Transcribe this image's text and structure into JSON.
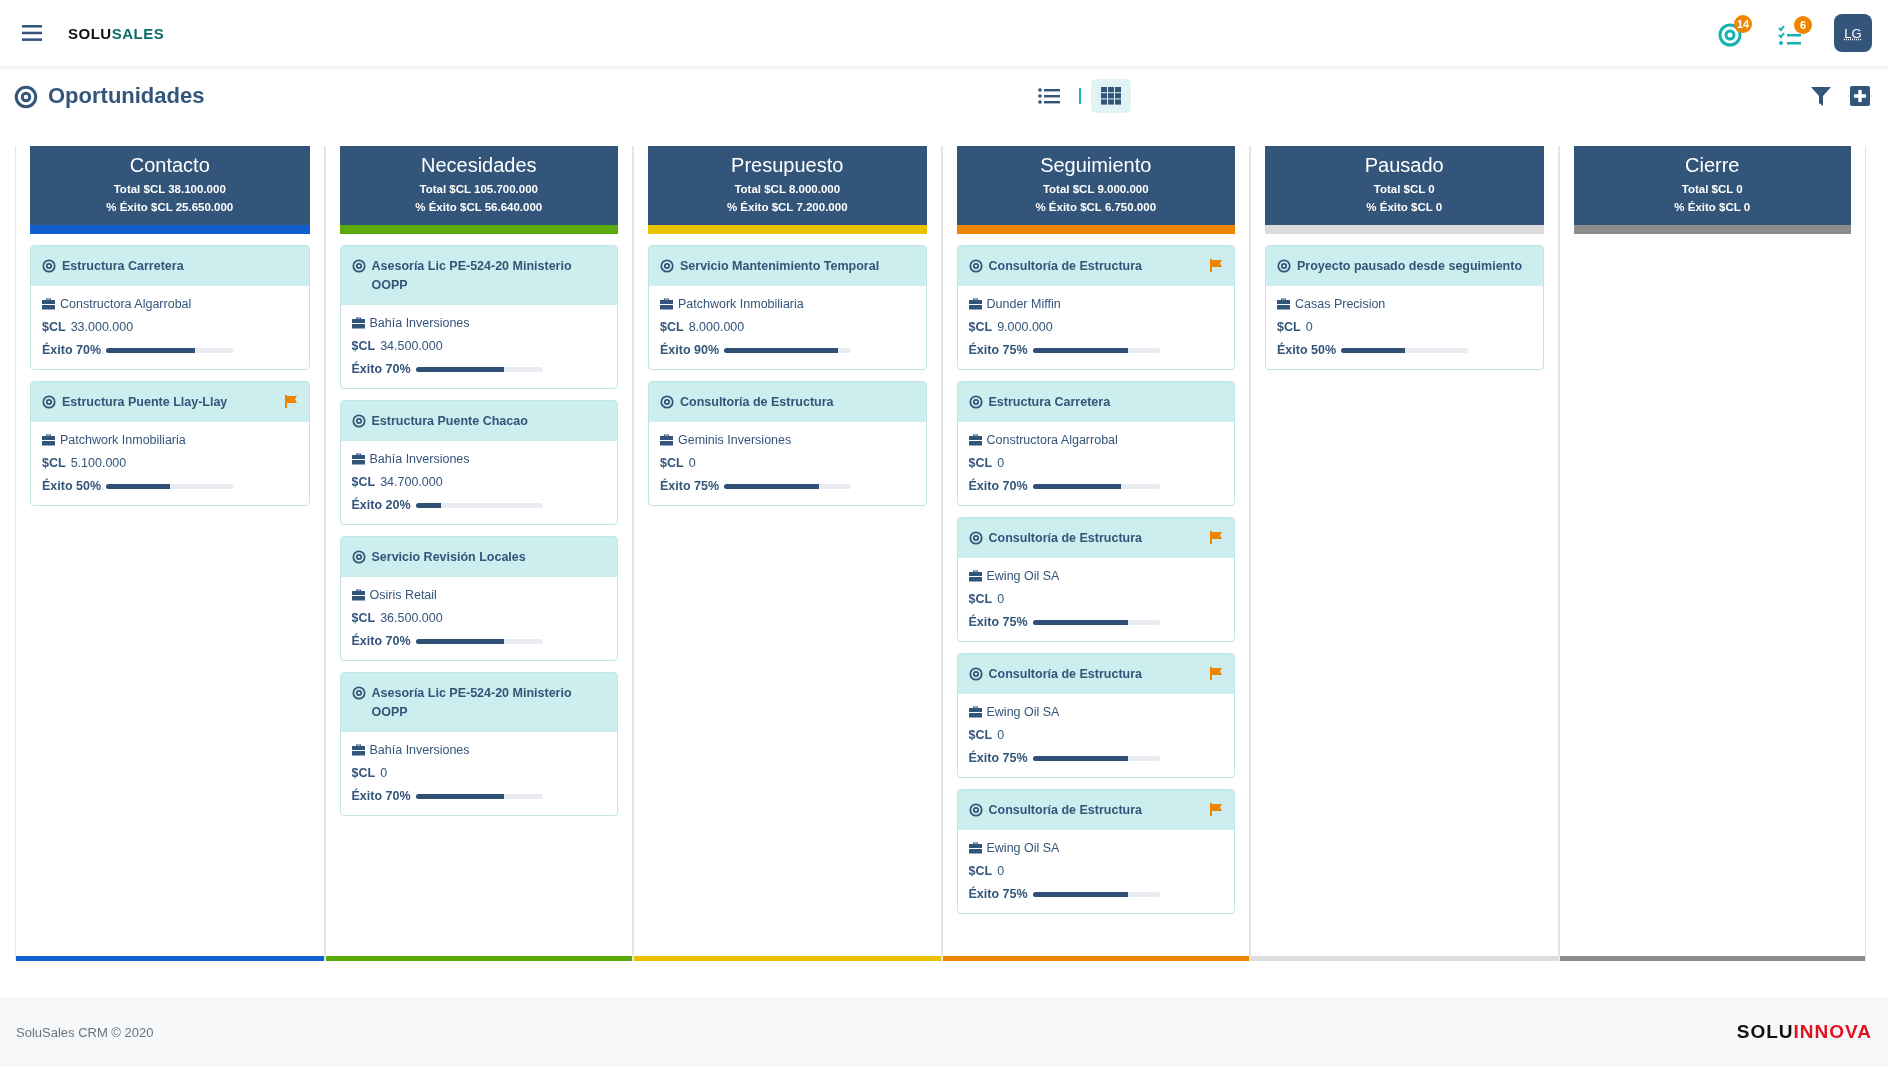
{
  "topbar": {
    "logo": {
      "left": "SOLU",
      "right": "SALES"
    },
    "notifications": [
      {
        "kind": "target",
        "count": "14"
      },
      {
        "kind": "tasks",
        "count": "6"
      }
    ],
    "avatar": "LG"
  },
  "page": {
    "title": "Oportunidades",
    "views": [
      {
        "kind": "list",
        "selected": false
      },
      {
        "kind": "grid",
        "selected": true
      }
    ]
  },
  "columns": [
    {
      "title": "Contacto",
      "total": "Total $CL 38.100.000",
      "success": "% Éxito $CL 25.650.000",
      "color": "#0f5fd0",
      "cards": [
        {
          "title": "Estructura Carretera",
          "flagged": false,
          "company": "Constructora Algarrobal",
          "currency": "$CL",
          "amount": "33.000.000",
          "success_label": "Éxito 70%",
          "level": 0.7
        },
        {
          "title": "Estructura Puente Llay-Llay",
          "flagged": true,
          "company": "Patchwork Inmobiliaria",
          "currency": "$CL",
          "amount": "5.100.000",
          "success_label": "Éxito 50%",
          "level": 0.5
        }
      ]
    },
    {
      "title": "Necesidades",
      "total": "Total $CL 105.700.000",
      "success": "% Éxito $CL 56.640.000",
      "color": "#5aab0a",
      "cards": [
        {
          "title": "Asesoría Lic PE-524-20 Ministerio OOPP",
          "flagged": false,
          "company": "Bahía Inversiones",
          "currency": "$CL",
          "amount": "34.500.000",
          "success_label": "Éxito 70%",
          "level": 0.7
        },
        {
          "title": "Estructura Puente Chacao",
          "flagged": false,
          "company": "Bahía Inversiones",
          "currency": "$CL",
          "amount": "34.700.000",
          "success_label": "Éxito 20%",
          "level": 0.2
        },
        {
          "title": "Servicio Revisión Locales",
          "flagged": false,
          "company": "Osiris Retail",
          "currency": "$CL",
          "amount": "36.500.000",
          "success_label": "Éxito 70%",
          "level": 0.7
        },
        {
          "title": "Asesoría Lic PE-524-20 Ministerio OOPP",
          "flagged": false,
          "company": "Bahía Inversiones",
          "currency": "$CL",
          "amount": "0",
          "success_label": "Éxito 70%",
          "level": 0.7
        }
      ]
    },
    {
      "title": "Presupuesto",
      "total": "Total $CL 8.000.000",
      "success": "% Éxito $CL 7.200.000",
      "color": "#e8c200",
      "cards": [
        {
          "title": "Servicio Mantenimiento Temporal",
          "flagged": false,
          "company": "Patchwork Inmobiliaria",
          "currency": "$CL",
          "amount": "8.000.000",
          "success_label": "Éxito 90%",
          "level": 0.9
        },
        {
          "title": "Consultoría de Estructura",
          "flagged": false,
          "company": "Geminis Inversiones",
          "currency": "$CL",
          "amount": "0",
          "success_label": "Éxito 75%",
          "level": 0.75
        }
      ]
    },
    {
      "title": "Seguimiento",
      "total": "Total $CL 9.000.000",
      "success": "% Éxito $CL 6.750.000",
      "color": "#ee8500",
      "cards": [
        {
          "title": "Consultoría de Estructura",
          "flagged": true,
          "company": "Dunder Miffin",
          "currency": "$CL",
          "amount": "9.000.000",
          "success_label": "Éxito 75%",
          "level": 0.75
        },
        {
          "title": "Estructura Carretera",
          "flagged": false,
          "company": "Constructora Algarrobal",
          "currency": "$CL",
          "amount": "0",
          "success_label": "Éxito 70%",
          "level": 0.7
        },
        {
          "title": "Consultoría de Estructura",
          "flagged": true,
          "company": "Ewing Oil SA",
          "currency": "$CL",
          "amount": "0",
          "success_label": "Éxito 75%",
          "level": 0.75
        },
        {
          "title": "Consultoría de Estructura",
          "flagged": true,
          "company": "Ewing Oil SA",
          "currency": "$CL",
          "amount": "0",
          "success_label": "Éxito 75%",
          "level": 0.75
        },
        {
          "title": "Consultoría de Estructura",
          "flagged": true,
          "company": "Ewing Oil SA",
          "currency": "$CL",
          "amount": "0",
          "success_label": "Éxito 75%",
          "level": 0.75
        }
      ]
    },
    {
      "title": "Pausado",
      "total": "Total $CL 0",
      "success": "% Éxito $CL 0",
      "color": "#dcdcdc",
      "cards": [
        {
          "title": "Proyecto pausado desde seguimiento",
          "flagged": false,
          "company": "Casas Precision",
          "currency": "$CL",
          "amount": "0",
          "success_label": "Éxito 50%",
          "level": 0.5
        }
      ]
    },
    {
      "title": "Cierre",
      "total": "Total $CL 0",
      "success": "% Éxito $CL 0",
      "color": "#8c8c8c"
    }
  ],
  "footer": {
    "copyright": "SoluSales CRM © 2020",
    "logo": {
      "left": "SOLU",
      "right": "INNOVA"
    }
  }
}
